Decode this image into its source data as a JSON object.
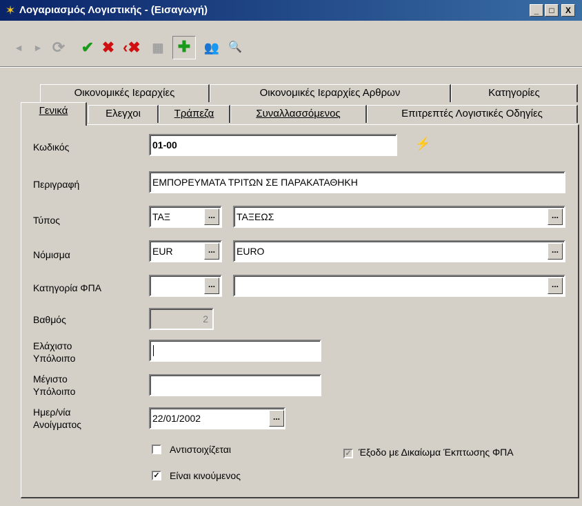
{
  "window": {
    "title": "Λογαριασμός Λογιστικής - (Εισαγωγή)",
    "minimize": "_",
    "maximize": "□",
    "close": "X"
  },
  "toolbar": {
    "prev": "◄",
    "next": "►",
    "refresh": "⟳",
    "accept": "✔",
    "cancel": "✖",
    "cancel_all": "‹✖",
    "calc": "▦",
    "add": "✚",
    "users": "👥",
    "find": "🔍"
  },
  "tabs_top": [
    {
      "label": "Οικονομικές Ιεραρχίες"
    },
    {
      "label": "Οικονομικές Ιεραρχίες Αρθρων"
    },
    {
      "label": "Κατηγορίες"
    }
  ],
  "tabs_bottom": [
    {
      "label": "Γενικά"
    },
    {
      "label": "Ελεγχοι"
    },
    {
      "label": "Τράπεζα"
    },
    {
      "label": "Συναλλασσόμενος"
    },
    {
      "label": "Επιτρεπτές Λογιστικές Οδηγίες"
    }
  ],
  "form": {
    "code_label": "Κωδικός",
    "code_value": "01-00",
    "desc_label": "Περιγραφή",
    "desc_value": "ΕΜΠΟΡΕΥΜΑΤΑ ΤΡΙΤΩΝ ΣΕ ΠΑΡΑΚΑΤΑΘΗΚΗ",
    "type_label": "Τύπος",
    "type_code": "ΤΑΞ",
    "type_name": "ΤΑΞΕΩΣ",
    "currency_label": "Νόμισμα",
    "currency_code": "EUR",
    "currency_name": "EURO",
    "vat_label": "Κατηγορία ΦΠΑ",
    "vat_code": "",
    "vat_name": "",
    "level_label": "Βαθμός",
    "level_value": "2",
    "min_label_1": "Ελάχιστο",
    "min_label_2": "Υπόλοιπο",
    "min_value": "",
    "max_label_1": "Μέγιστο",
    "max_label_2": "Υπόλοιπο",
    "max_value": "",
    "date_label_1": "Ημερ/νία",
    "date_label_2": "Ανοίγματος",
    "date_value": "22/01/2002",
    "ellipsis": "...",
    "cb_match_label": "Αντιστοιχίζεται",
    "cb_match_checked": false,
    "cb_vat_label": "Έξοδο με Δικαίωμα Έκπτωσης ΦΠΑ",
    "cb_vat_checked": true,
    "cb_moving_label": "Είναι κινούμενος",
    "cb_moving_checked": true,
    "check_mark": "✓"
  }
}
